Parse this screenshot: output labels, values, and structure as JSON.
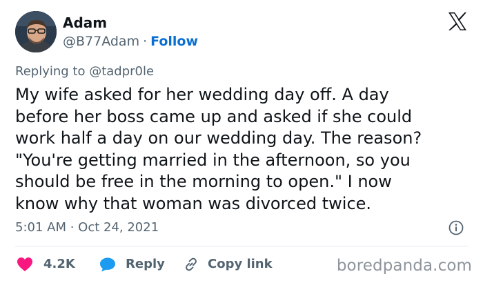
{
  "author": {
    "name": "Adam",
    "handle": "@B77Adam",
    "separator": "·",
    "follow_label": "Follow",
    "avatar_icon": "user-photo-avatar"
  },
  "platform_logo": "x-logo-icon",
  "reply": {
    "prefix": "Replying to ",
    "to": "@tadpr0le"
  },
  "tweet": {
    "text": "My wife asked for her wedding day off.  A day\nbefore her boss came up and asked if she could\nwork half a day on our wedding day.  The reason?\n\"You're getting married in the afternoon, so you\nshould be free in the morning to open.\"  I now\nknow why that woman was divorced twice."
  },
  "meta": {
    "timestamp": "5:01 AM · Oct 24, 2021",
    "info_icon": "info-icon"
  },
  "actions": {
    "like_count": "4.2K",
    "reply_label": "Reply",
    "copy_link_label": "Copy link"
  },
  "watermark": "boredpanda.com",
  "colors": {
    "text": "#0f1419",
    "secondary": "#536471",
    "link": "#0a6fd2",
    "like": "#f91880",
    "reply_icon": "#1d9bf0",
    "divider": "#e3e8ec",
    "watermark": "#8e959c"
  }
}
